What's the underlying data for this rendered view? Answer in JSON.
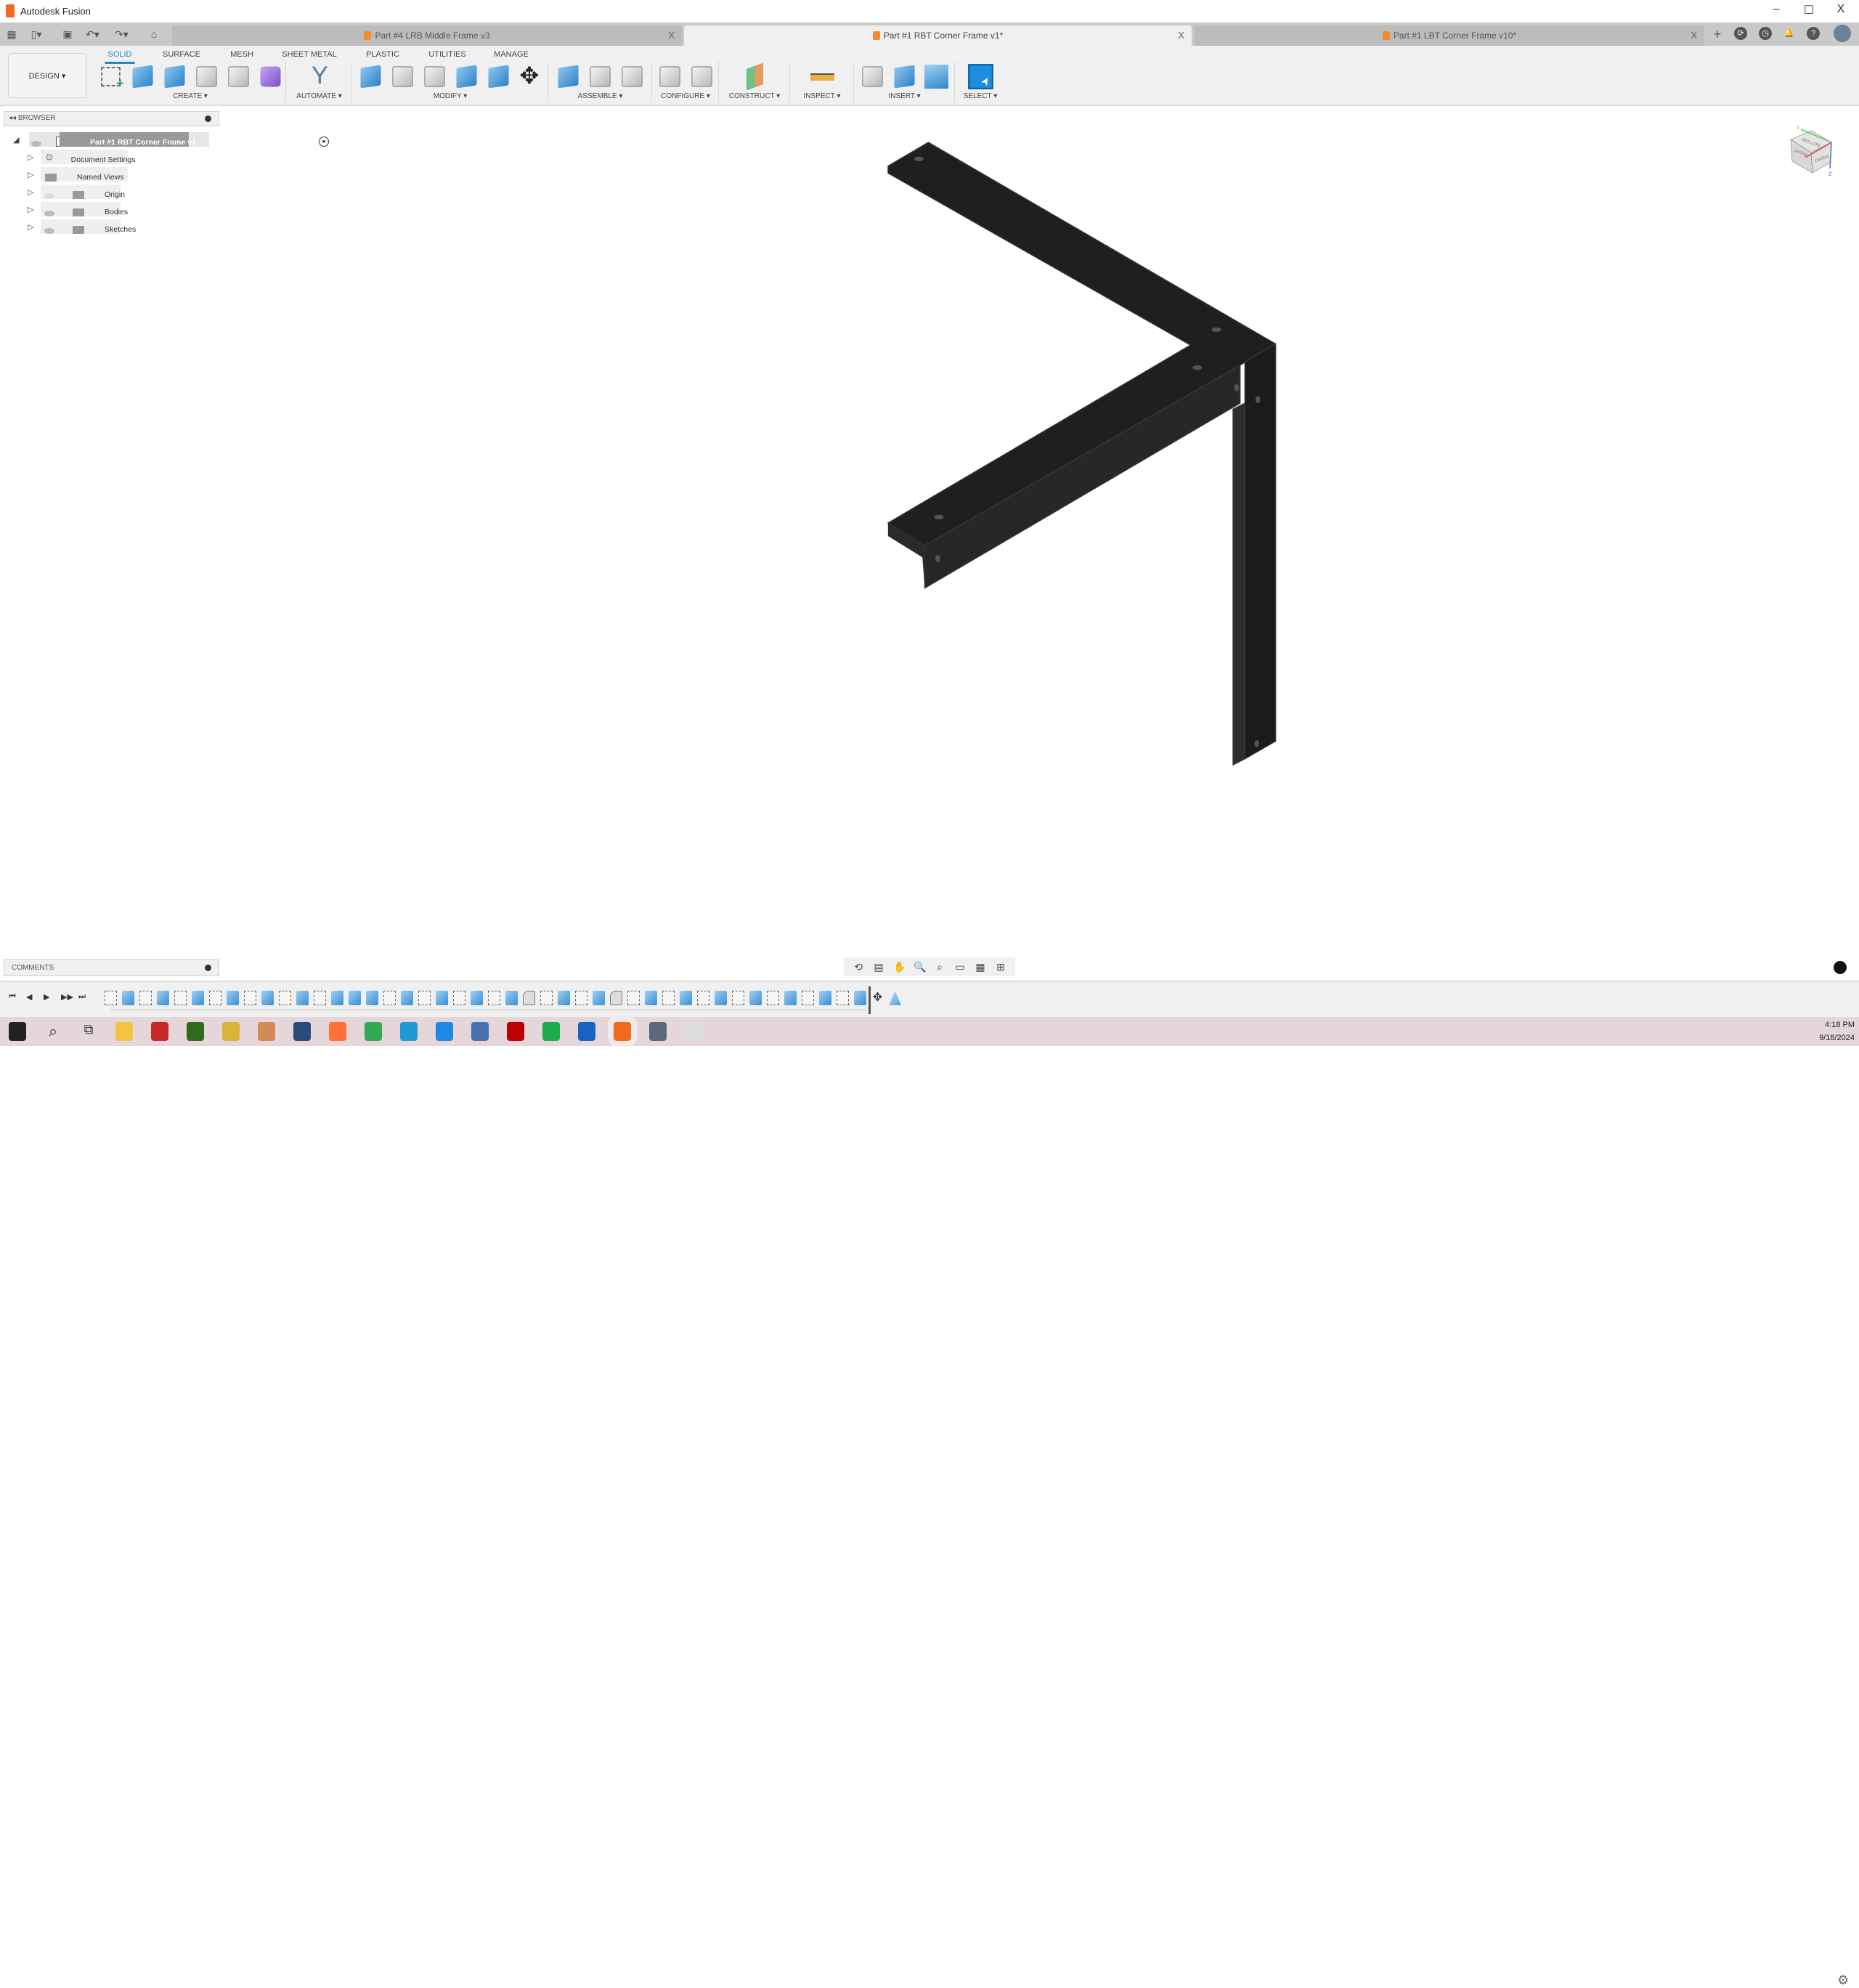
{
  "app": {
    "title": "Autodesk Fusion",
    "brand_color": "#f26a1b"
  },
  "window_controls": {
    "minimize": "–",
    "maximize": "☐",
    "close": "X"
  },
  "document_tabs": [
    {
      "label": "Part #4 LRB Middle Frame v3",
      "active": false
    },
    {
      "label": "Part #1 RBT Corner Frame v1*",
      "active": true
    },
    {
      "label": "Part #1 LBT Corner Frame v10*",
      "active": false
    }
  ],
  "workspace": {
    "label": "DESIGN ▾"
  },
  "ribbon_tabs": [
    {
      "label": "SOLID",
      "active": true
    },
    {
      "label": "SURFACE"
    },
    {
      "label": "MESH"
    },
    {
      "label": "SHEET METAL"
    },
    {
      "label": "PLASTIC"
    },
    {
      "label": "UTILITIES"
    },
    {
      "label": "MANAGE"
    }
  ],
  "ribbon_groups": [
    {
      "label": "CREATE ▾",
      "icons": [
        "create-sketch-icon:sketch",
        "extrude-icon:blue",
        "revolve-icon:blue",
        "hole-icon:gray",
        "pattern-icon:gray",
        "create-form-icon:purple"
      ]
    },
    {
      "label": "AUTOMATE ▾",
      "icons": [
        "automate-icon:automate"
      ]
    },
    {
      "label": "MODIFY ▾",
      "icons": [
        "press-pull-icon:blue",
        "fillet-icon:gray",
        "shell-icon:gray",
        "combine-icon:blue",
        "split-icon:blue",
        "move-copy-icon:move"
      ]
    },
    {
      "label": "ASSEMBLE ▾",
      "icons": [
        "new-component-icon:blue",
        "joint-icon:gray",
        "bill-of-materials-icon:gray"
      ]
    },
    {
      "label": "CONFIGURE ▾",
      "icons": [
        "configure-icon:gray",
        "configuration-table-icon:gray"
      ]
    },
    {
      "label": "CONSTRUCT ▾",
      "icons": [
        "offset-plane-icon:construct"
      ]
    },
    {
      "label": "INSPECT ▾",
      "icons": [
        "measure-icon:inspect"
      ]
    },
    {
      "label": "INSERT ▾",
      "icons": [
        "insert-derive-icon:gray",
        "insert-mcmaster-icon:blue",
        "insert-canvas-icon:image"
      ]
    },
    {
      "label": "SELECT ▾",
      "icons": [
        "select-icon:select"
      ]
    }
  ],
  "browser": {
    "title": "BROWSER",
    "root": "Part #1 RBT Corner Frame v1",
    "items": [
      {
        "label": "Document Settings",
        "icon": "gear-icon"
      },
      {
        "label": "Named Views",
        "icon": "folder-icon"
      },
      {
        "label": "Origin",
        "icon": "folder-icon",
        "visible": false
      },
      {
        "label": "Bodies",
        "icon": "folder-icon",
        "visible": true
      },
      {
        "label": "Sketches",
        "icon": "folder-icon",
        "visible": true
      }
    ]
  },
  "viewcube": {
    "faces": [
      "BOTTOM",
      "FRONT",
      "RIGHT"
    ],
    "axes": [
      "X",
      "Y",
      "Z"
    ],
    "colors": {
      "x": "#e04040",
      "y": "#60d060",
      "z": "#6060e0"
    }
  },
  "comments": {
    "title": "COMMENTS"
  },
  "navbar": [
    "orbit-icon:⟲",
    "look-at-icon:▤",
    "pan-icon:✋",
    "zoom-icon:🔍",
    "fit-icon:⌕",
    "display-settings-icon:▭",
    "grid-settings-icon:▦",
    "viewports-icon:⊞"
  ],
  "timeline": {
    "controls": [
      "⏮",
      "◀",
      "▶",
      "▶▶",
      "⏭"
    ],
    "items": [
      "sketch",
      "extrude",
      "sketch",
      "extrude",
      "sketch",
      "extrude",
      "sketch",
      "extrude",
      "sketch",
      "extrude",
      "sketch",
      "extrude",
      "sketch",
      "extrude",
      "extrude",
      "extrude",
      "sketch",
      "extrude",
      "sketch",
      "extrude",
      "sketch",
      "extrude",
      "sketch",
      "extrude",
      "fillet",
      "sketch",
      "extrude",
      "sketch",
      "extrude",
      "fillet",
      "sketch",
      "extrude",
      "sketch",
      "extrude",
      "sketch",
      "extrude",
      "sketch",
      "extrude",
      "sketch",
      "extrude",
      "sketch",
      "extrude",
      "sketch",
      "extrude",
      "move",
      "draft"
    ]
  },
  "taskbar": {
    "apps": [
      "start:#222",
      "search:#fff",
      "task-view:#fff",
      "file-explorer:#f3c343",
      "es-app:#c62828",
      "ss-app:#2e6b1f",
      "editor:#d9b33a",
      "paint:#d48a52",
      "vpn:#2a4a7a",
      "firefox:#ff7139",
      "chrome:#34a853",
      "edge:#1f9ad6",
      "vscode:#1e88e5",
      "network:#4a6fb5",
      "filezilla:#bf0000",
      "sheets:#1faa4b",
      "c-app:#1565c0",
      "fusion:#f26a1b",
      "calculator:#5a6a7a",
      "gimp:#dddddd"
    ],
    "time": "4:18 PM",
    "date": "9/18/2024"
  }
}
